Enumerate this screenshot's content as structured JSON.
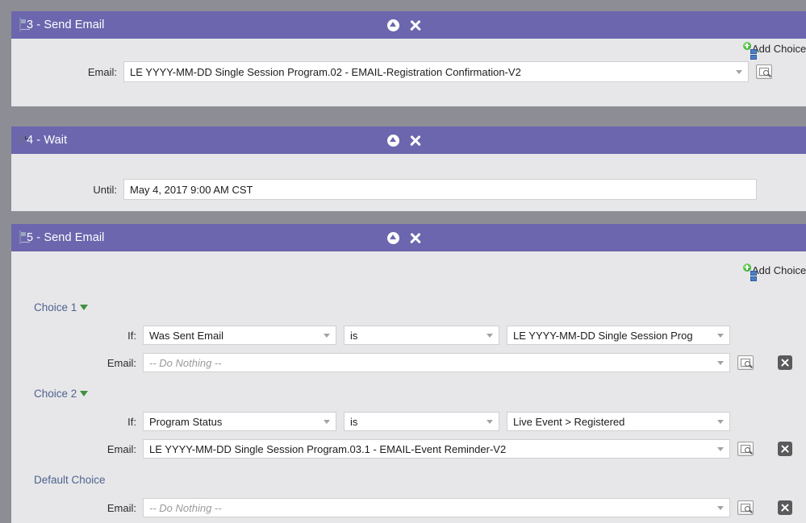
{
  "panels": [
    {
      "id": "step3",
      "number": "3",
      "title": "3 - Send Email",
      "icon": "email-icon",
      "add_choice_label": "Add Choice",
      "email_label": "Email:",
      "email_value": "LE YYYY-MM-DD Single Session Program.02 - EMAIL-Registration Confirmation-V2"
    },
    {
      "id": "step4",
      "number": "4",
      "title": "4 - Wait",
      "icon": "clock-icon",
      "until_label": "Until:",
      "until_value": "May 4, 2017 9:00 AM CST"
    },
    {
      "id": "step5",
      "number": "5",
      "title": "5 - Send Email",
      "icon": "email-icon",
      "add_choice_label": "Add Choice"
    }
  ],
  "choices": [
    {
      "heading": "Choice 1",
      "if_label": "If:",
      "if_value": "Was Sent Email",
      "operator_value": "is",
      "target_value": "LE YYYY-MM-DD Single Session Prog",
      "email_label": "Email:",
      "email_value": "-- Do Nothing --",
      "email_is_placeholder": true
    },
    {
      "heading": "Choice 2",
      "if_label": "If:",
      "if_value": "Program Status",
      "operator_value": "is",
      "target_value": "Live Event > Registered",
      "email_label": "Email:",
      "email_value": "LE YYYY-MM-DD Single Session Program.03.1 - EMAIL-Event Reminder-V2",
      "email_is_placeholder": false
    }
  ],
  "default_choice": {
    "heading": "Default Choice",
    "email_label": "Email:",
    "email_value": "-- Do Nothing --",
    "email_is_placeholder": true
  },
  "colors": {
    "header_purple": "#6b66ae",
    "panel_body": "#e7e7e9",
    "page_background": "#8d8d95",
    "link_blue": "#4d6390",
    "green_accent": "#3fae34"
  }
}
